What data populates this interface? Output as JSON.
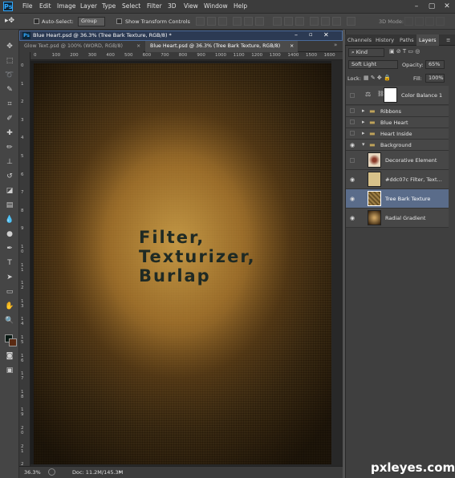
{
  "app": {
    "logo": "Ps"
  },
  "menu": [
    "File",
    "Edit",
    "Image",
    "Layer",
    "Type",
    "Select",
    "Filter",
    "3D",
    "View",
    "Window",
    "Help"
  ],
  "options": {
    "auto_select_label": "Auto-Select:",
    "auto_select_value": "Group",
    "transform_label": "Show Transform Controls",
    "mode_3d": "3D Mode:"
  },
  "document": {
    "active_tab": "Blue Heart.psd @ 36.3% (Tree Bark Texture, RGB/8) *",
    "tabs": [
      "Glow Text.psd @ 100% (WORD, RGB/8)",
      "Blue Heart.psd @ 36.3% (Tree Bark Texture, RGB/8)"
    ],
    "ruler_ticks": [
      "0",
      "100",
      "200",
      "300",
      "400",
      "500",
      "600",
      "700",
      "800",
      "900",
      "1000",
      "1100",
      "1200",
      "1300",
      "1400",
      "1500",
      "1600"
    ],
    "ruler_v_ticks": [
      "0",
      "1",
      "2",
      "3",
      "4",
      "5",
      "6",
      "7",
      "8",
      "9",
      "1\n0",
      "1\n1",
      "1\n2",
      "1\n3",
      "1\n4",
      "1\n5",
      "1\n6",
      "1\n7",
      "1\n8",
      "1\n9",
      "2\n0",
      "2\n1",
      "2\n2"
    ],
    "canvas_text": "Filter,\nTexturizer,\nBurlap"
  },
  "status": {
    "zoom": "36.3%",
    "doc": "Doc: 11.2M/145.3M"
  },
  "panel": {
    "tabs": [
      "Channels",
      "History",
      "Paths",
      "Layers"
    ],
    "active_tab": "Layers",
    "filter_kind": "Kind",
    "blend_mode": "Soft Light",
    "opacity_label": "Opacity:",
    "opacity_value": "65%",
    "lock_label": "Lock:",
    "fill_label": "Fill:",
    "fill_value": "100%",
    "layers": [
      {
        "name": "Color Balance 1",
        "visible": false,
        "type": "adjustment"
      },
      {
        "name": "Ribbons",
        "visible": false,
        "type": "group"
      },
      {
        "name": "Blue Heart",
        "visible": false,
        "type": "group"
      },
      {
        "name": "Heart Inside",
        "visible": false,
        "type": "group"
      },
      {
        "name": "Background",
        "visible": true,
        "type": "group"
      },
      {
        "name": "Decorative Element",
        "visible": false,
        "type": "layer"
      },
      {
        "name": "#ddc07c  Filter, Text...",
        "visible": true,
        "type": "layer"
      },
      {
        "name": "Tree Bark Texture",
        "visible": true,
        "type": "layer",
        "selected": true
      },
      {
        "name": "Radial Gradient",
        "visible": true,
        "type": "layer"
      }
    ]
  },
  "watermark": "pxleyes.com",
  "colors": {
    "accent": "#31a8ff",
    "selected_layer": "#5a6c8a",
    "text_fill": "#1f2a24"
  }
}
